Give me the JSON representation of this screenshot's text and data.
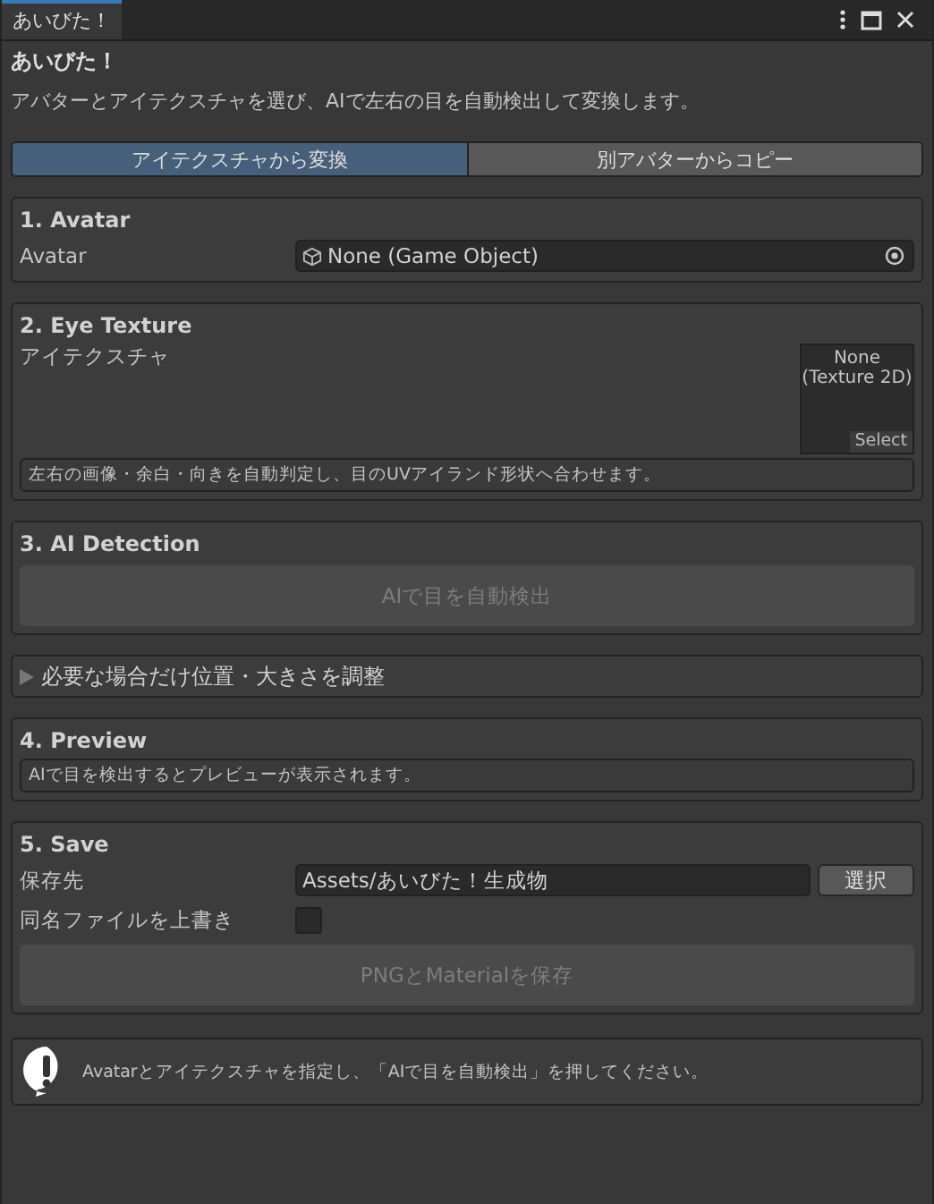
{
  "window": {
    "tab_title": "あいびた！"
  },
  "header": {
    "title": "あいびた！",
    "description": "アバターとアイテクスチャを選び、AIで左右の目を自動検出して変換します。"
  },
  "mode_tabs": [
    {
      "label": "アイテクスチャから変換",
      "selected": true
    },
    {
      "label": "別アバターからコピー",
      "selected": false
    }
  ],
  "avatar_section": {
    "title": "1. Avatar",
    "field_label": "Avatar",
    "field_value": "None (Game Object)"
  },
  "texture_section": {
    "title": "2. Eye Texture",
    "field_label": "アイテクスチャ",
    "slot_text": "None\n(Texture 2D)",
    "slot_button": "Select",
    "note": "左右の画像・余白・向きを自動判定し、目のUVアイランド形状へ合わせます。"
  },
  "detection_section": {
    "title": "3. AI Detection",
    "button": {
      "label": "AIで目を自動検出",
      "disabled": true
    }
  },
  "adjust_foldout": {
    "label": "必要な場合だけ位置・大きさを調整",
    "expanded": false
  },
  "preview_section": {
    "title": "4. Preview",
    "note": "AIで目を検出するとプレビューが表示されます。"
  },
  "save_section": {
    "title": "5. Save",
    "path_label": "保存先",
    "path_value": "Assets/あいびた！生成物",
    "browse_button": "選択",
    "overwrite_label": "同名ファイルを上書き",
    "overwrite_checked": false,
    "button": {
      "label": "PNGとMaterialを保存",
      "disabled": true
    }
  },
  "help_box": {
    "message": "Avatarとアイテクスチャを指定し、「AIで目を自動検出」を押してください。"
  }
}
